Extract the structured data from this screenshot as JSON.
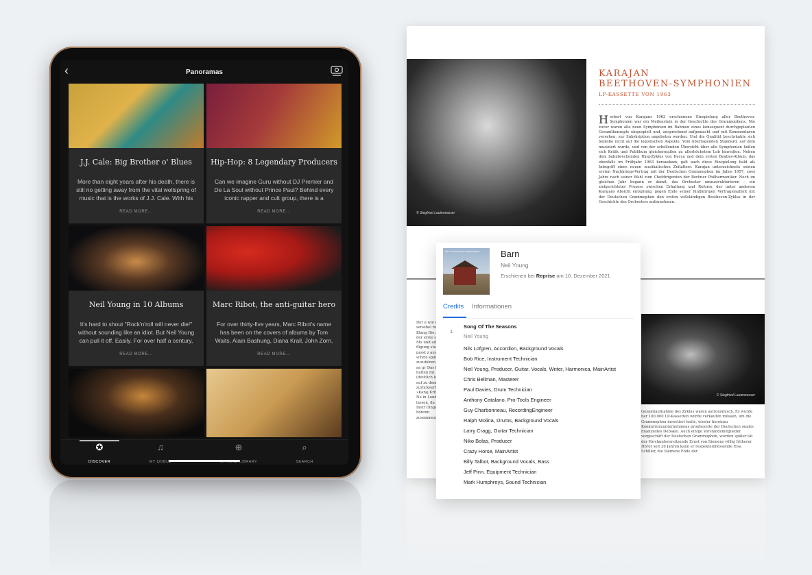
{
  "tablet": {
    "header_title": "Panoramas",
    "cards": [
      {
        "title": "J.J. Cale: Big Brother o' Blues",
        "desc": "More than eight years after his death, there is still no getting away from the vital wellspring of music that is the works of J.J. Cale. With his",
        "more": "READ MORE..."
      },
      {
        "title": "Hip-Hop: 8 Legendary Producers",
        "desc": "Can we imagine Guru without DJ Premier and De La Soul without Prince Paul? Behind every iconic rapper and cult group, there is a visionary",
        "more": "READ MORE..."
      },
      {
        "title": "Neil Young in 10 Albums",
        "desc": "It's hard to shout \"Rock'n'roll will never die!\" without sounding like an idiot. But Neil Young can pull it off. Easily. For over half a century, the",
        "more": "READ MORE..."
      },
      {
        "title": "Marc Ribot, the anti-guitar hero",
        "desc": "For over thirty-five years, Marc Ribot's name has been on the covers of albums by Tom Waits, Alain Bashung, Diana Krall, John Zorn, Robert",
        "more": "READ MORE..."
      }
    ],
    "nav": [
      {
        "label": "DISCOVER"
      },
      {
        "label": "MY QOBUZ"
      },
      {
        "label": "OFFLINE LIBRARY"
      },
      {
        "label": "SEARCH"
      }
    ]
  },
  "booklet": {
    "title_line1": "KARAJAN",
    "title_line2": "BEETHOVEN-SYMPHONIEN",
    "subtitle": "LP-KASSETTE VON 1963",
    "photo_credit": "© Siegfried Lauterwasser",
    "photo_credit_2": "© Siegfried Lauterwasser",
    "dropcap": "H",
    "body": "erbert von Karajans 1963 erschienene Einspielung aller Beethoven-Symphonien war ein Meilenstein in der Geschichte des Grammophons. Nie zuvor waren alle neun Symphonien im Rahmen eines konsequent durchgeplanten Gesamtkonzepts eingespielt und, ansprechend aufgemacht und mit Kommentaren versehen, zur Subskription angeboten worden. Und die Qualität beschränkte sich beileibe nicht auf die logistischen Aspekte. Vom überragenden Standard, auf dem musiziert wurde, und von der erhellenden Übersicht über alle Symphonien ließen sich Kritik und Publikum gleichermaßen zu allerhöchstem Lob hinreißen. Neben dem bahnbrechenden Ring-Zyklus von Decca und dem ersten Beatles-Album, das ebenfalls im Frühjahr 1963 herauskam, galt auch diese Einspielung bald als Inbegriff eines neuen musikalischen Zeitalters. Karajan unterzeichnete seinen ersten Nachkriegs-Vertrag mit der Deutschen Grammophon im Jahre 1957, zwei Jahre nach seiner Wahl zum Chefdirigenten der Berliner Philharmoniker. Noch im gleichen Jahr begann er damit, das Orchester umzustrukturieren – ein zielgerichteter Prozess zwischen Erhaltung und Reform, der unter anderem Karajans Absicht entsprang, gegen Ende seiner fünfjährigen Vertragslaufzeit mit der Deutschen Grammophon den ersten vollständigen Beethoven-Zyklus in der Geschichte des Orchesters aufzunehmen.",
    "lower_left": "Der e wie einer sensibel re das Klang Die Au In der erste seinen Mu und adäqu fügung sta und passt z aus, schrie später der zuzuhören Arbeit an gr Das Er haften Int (deutlich k kann auf zu dem zurückverf bei »Karaj Kritiker Ne in London lassen, da jeder Instr Dinge hörenn zusammen",
    "lower_right": "Gesamtaufnahme des Zyklus waren astronomisch. Es wurde bar 100.000 LP-Kassetten würde verkaufen müssen, um die Grammophon investiert hatte, wieder hereinzu Konkurrenzunternehmens prophezeite der Deutschen ouales finanzielles Debakel. Auch einige Vorstandsmitglieder vergeschäft der Deutschen Grammophon, wurden später tät der Vorstandsvorsitzende Ernst von Siemens völlig früherer Hörer seit 20 Jahren kann er respekteinflössende Elsa Schiller, die Siemens Ende der"
  },
  "album": {
    "title": "Barn",
    "artist": "Neil Young",
    "release_prefix": "Erschienen bei",
    "label": "Reprise",
    "release_suffix": "am 10. Dezember 2021",
    "cover_text": "NEIL YOUNG CRAZY HORSE BARN",
    "tab_credits": "Credits",
    "tab_info": "Informationen",
    "track_number": "1",
    "track_title": "Song Of The Seasons",
    "track_artist": "Neil Young",
    "credits": [
      "Nils Lofgren, Accordion, Background Vocals",
      "Bob Rice, Instrument Technician",
      "Neil Young, Producer, Guitar, Vocals, Writer, Harmonica, MainArtist",
      "Chris Bellman, Masterer",
      "Paul Davies, Drum Technician",
      "Anthony Catalano, Pro-Tools Engineer",
      "Guy Charbonneau, RecordingEngineer",
      "Ralph Molina, Drums, Background Vocals",
      "Larry Cragg, Guitar Technician",
      "Niko Bolas, Producer",
      "Crazy Horse, MainArtist",
      "Billy Talbot, Background Vocals, Bass",
      "Jeff Pinn, Equipment Technician",
      "Mark Humphreys, Sound Technician"
    ]
  },
  "colors": {
    "accent_blue": "#1f6fe0",
    "booklet_red": "#c0502e",
    "tablet_frame": "#a07a5a"
  }
}
